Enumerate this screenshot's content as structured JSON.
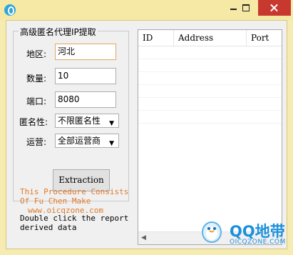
{
  "window": {
    "controls": {
      "minimize": "minimize-icon",
      "maximize": "maximize-icon",
      "close": "close-icon"
    }
  },
  "group": {
    "title": "高级匿名代理IP提取",
    "region_label": "地区:",
    "region_value": "河北",
    "count_label": "数量:",
    "count_value": "10",
    "port_label": "端口:",
    "port_value": "8080",
    "anon_label": "匿名性:",
    "anon_value": "不限匿名性",
    "carrier_label": "运营:",
    "carrier_value": "全部运营商",
    "extract_label": "Extraction"
  },
  "credit": {
    "line1": "This Procedure Consists",
    "line2": "Of Fu Chen Make",
    "line3": "www.oicqzone.com"
  },
  "hint": "Double click the report derived data",
  "list": {
    "columns": [
      "ID",
      "Address",
      "Port"
    ],
    "rows": []
  },
  "watermark": {
    "text": "QQ地带",
    "sub": "OICQZONE.COM"
  },
  "colors": {
    "credit": "#e07a2c",
    "titlebar": "#f6e9a6",
    "close": "#c7392f",
    "watermark": "#1a8fdc"
  }
}
